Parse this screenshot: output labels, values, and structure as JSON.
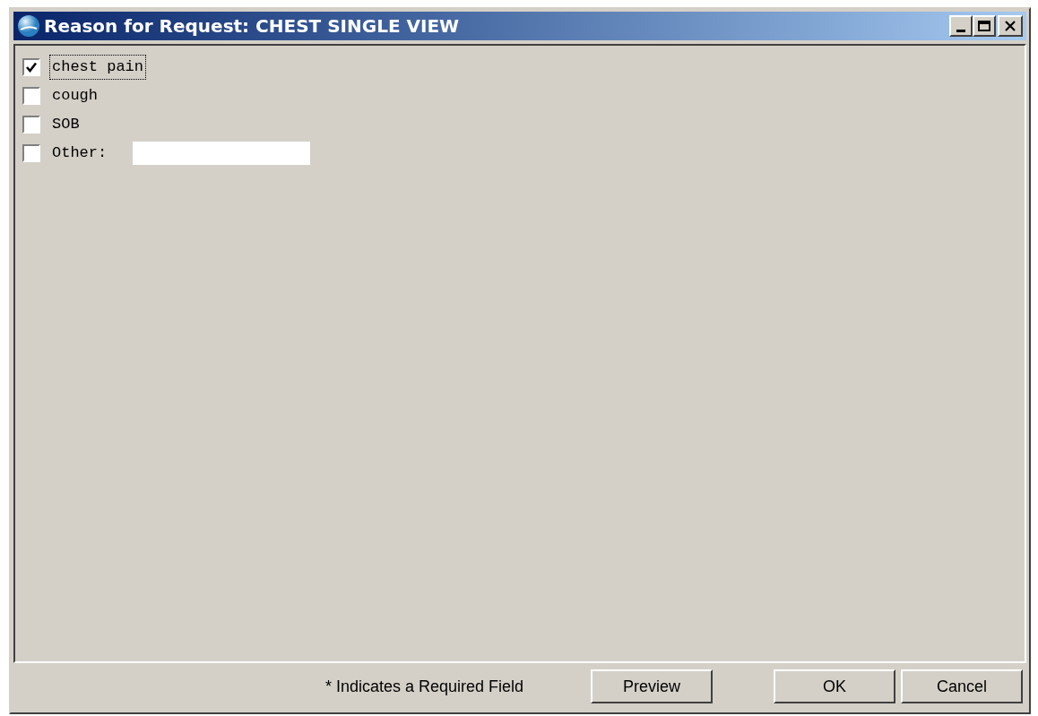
{
  "window": {
    "title": "Reason for Request: CHEST SINGLE VIEW"
  },
  "options": [
    {
      "kind": "checkbox",
      "label": "chest pain",
      "checked": true,
      "focused": true
    },
    {
      "kind": "checkbox",
      "label": "cough",
      "checked": false,
      "focused": false
    },
    {
      "kind": "checkbox",
      "label": "SOB",
      "checked": false,
      "focused": false
    },
    {
      "kind": "checkbox-with-field",
      "label": "Other:",
      "checked": false,
      "focused": false
    }
  ],
  "footer": {
    "note": "* Indicates a Required Field",
    "buttons": [
      {
        "label": "Preview",
        "kind": "preview"
      },
      {
        "label": "OK",
        "kind": "ok"
      },
      {
        "label": "Cancel",
        "kind": "cancel"
      }
    ]
  }
}
